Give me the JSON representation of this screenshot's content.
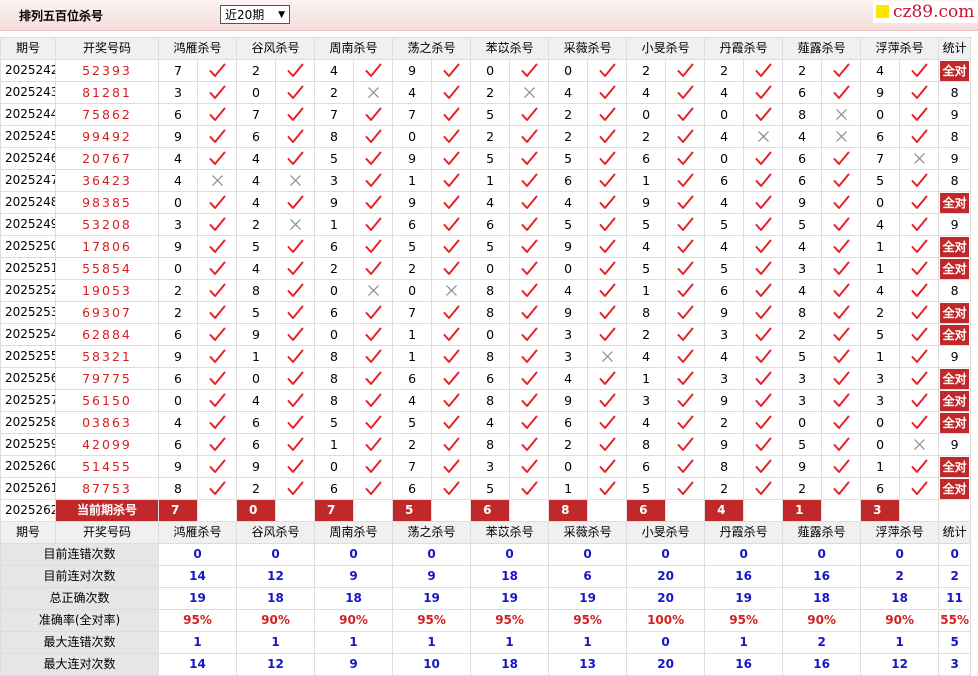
{
  "header": {
    "title": "排列五百位杀号",
    "select_value": "近20期",
    "logo_text": "cz89.com"
  },
  "columns": {
    "issue": "期号",
    "code": "开奖号码",
    "stat": "统计"
  },
  "experts": [
    "鸿雁杀号",
    "谷风杀号",
    "周南杀号",
    "荡之杀号",
    "苯苡杀号",
    "采薇杀号",
    "小旻杀号",
    "丹霞杀号",
    "薤露杀号",
    "浮萍杀号"
  ],
  "rows": [
    {
      "issue": "2025242",
      "code": "52393",
      "picks": [
        7,
        2,
        4,
        9,
        0,
        0,
        2,
        2,
        2,
        4
      ],
      "hits": [
        1,
        1,
        1,
        1,
        1,
        1,
        1,
        1,
        1,
        1
      ],
      "stat": "全对"
    },
    {
      "issue": "2025243",
      "code": "81281",
      "picks": [
        3,
        0,
        2,
        4,
        2,
        4,
        4,
        4,
        6,
        9
      ],
      "hits": [
        1,
        1,
        0,
        1,
        0,
        1,
        1,
        1,
        1,
        1
      ],
      "stat": "8"
    },
    {
      "issue": "2025244",
      "code": "75862",
      "picks": [
        6,
        7,
        7,
        7,
        5,
        2,
        0,
        0,
        8,
        0
      ],
      "hits": [
        1,
        1,
        1,
        1,
        1,
        1,
        1,
        1,
        0,
        1
      ],
      "stat": "9"
    },
    {
      "issue": "2025245",
      "code": "99492",
      "picks": [
        9,
        6,
        8,
        0,
        2,
        2,
        2,
        4,
        4,
        6
      ],
      "hits": [
        1,
        1,
        1,
        1,
        1,
        1,
        1,
        0,
        0,
        1
      ],
      "stat": "8"
    },
    {
      "issue": "2025246",
      "code": "20767",
      "picks": [
        4,
        4,
        5,
        9,
        5,
        5,
        6,
        0,
        6,
        7
      ],
      "hits": [
        1,
        1,
        1,
        1,
        1,
        1,
        1,
        1,
        1,
        0
      ],
      "stat": "9"
    },
    {
      "issue": "2025247",
      "code": "36423",
      "picks": [
        4,
        4,
        3,
        1,
        1,
        6,
        1,
        6,
        6,
        5
      ],
      "hits": [
        0,
        0,
        1,
        1,
        1,
        1,
        1,
        1,
        1,
        1
      ],
      "stat": "8"
    },
    {
      "issue": "2025248",
      "code": "98385",
      "picks": [
        0,
        4,
        9,
        9,
        4,
        4,
        9,
        4,
        9,
        0
      ],
      "hits": [
        1,
        1,
        1,
        1,
        1,
        1,
        1,
        1,
        1,
        1
      ],
      "stat": "全对"
    },
    {
      "issue": "2025249",
      "code": "53208",
      "picks": [
        3,
        2,
        1,
        6,
        6,
        5,
        5,
        5,
        5,
        4
      ],
      "hits": [
        1,
        0,
        1,
        1,
        1,
        1,
        1,
        1,
        1,
        1
      ],
      "stat": "9"
    },
    {
      "issue": "2025250",
      "code": "17806",
      "picks": [
        9,
        5,
        6,
        5,
        5,
        9,
        4,
        4,
        4,
        1
      ],
      "hits": [
        1,
        1,
        1,
        1,
        1,
        1,
        1,
        1,
        1,
        1
      ],
      "stat": "全对"
    },
    {
      "issue": "2025251",
      "code": "55854",
      "picks": [
        0,
        4,
        2,
        2,
        0,
        0,
        5,
        5,
        3,
        1
      ],
      "hits": [
        1,
        1,
        1,
        1,
        1,
        1,
        1,
        1,
        1,
        1
      ],
      "stat": "全对"
    },
    {
      "issue": "2025252",
      "code": "19053",
      "picks": [
        2,
        8,
        0,
        0,
        8,
        4,
        1,
        6,
        4,
        4
      ],
      "hits": [
        1,
        1,
        0,
        0,
        1,
        1,
        1,
        1,
        1,
        1
      ],
      "stat": "8"
    },
    {
      "issue": "2025253",
      "code": "69307",
      "picks": [
        2,
        5,
        6,
        7,
        8,
        9,
        8,
        9,
        8,
        2
      ],
      "hits": [
        1,
        1,
        1,
        1,
        1,
        1,
        1,
        1,
        1,
        1
      ],
      "stat": "全对"
    },
    {
      "issue": "2025254",
      "code": "62884",
      "picks": [
        6,
        9,
        0,
        1,
        0,
        3,
        2,
        3,
        2,
        5
      ],
      "hits": [
        1,
        1,
        1,
        1,
        1,
        1,
        1,
        1,
        1,
        1
      ],
      "stat": "全对"
    },
    {
      "issue": "2025255",
      "code": "58321",
      "picks": [
        9,
        1,
        8,
        1,
        8,
        3,
        4,
        4,
        5,
        1
      ],
      "hits": [
        1,
        1,
        1,
        1,
        1,
        0,
        1,
        1,
        1,
        1
      ],
      "stat": "9"
    },
    {
      "issue": "2025256",
      "code": "79775",
      "picks": [
        6,
        0,
        8,
        6,
        6,
        4,
        1,
        3,
        3,
        3
      ],
      "hits": [
        1,
        1,
        1,
        1,
        1,
        1,
        1,
        1,
        1,
        1
      ],
      "stat": "全对"
    },
    {
      "issue": "2025257",
      "code": "56150",
      "picks": [
        0,
        4,
        8,
        4,
        8,
        9,
        3,
        9,
        3,
        3
      ],
      "hits": [
        1,
        1,
        1,
        1,
        1,
        1,
        1,
        1,
        1,
        1
      ],
      "stat": "全对"
    },
    {
      "issue": "2025258",
      "code": "03863",
      "picks": [
        4,
        6,
        5,
        5,
        4,
        6,
        4,
        2,
        0,
        0
      ],
      "hits": [
        1,
        1,
        1,
        1,
        1,
        1,
        1,
        1,
        1,
        1
      ],
      "stat": "全对"
    },
    {
      "issue": "2025259",
      "code": "42099",
      "picks": [
        6,
        6,
        1,
        2,
        8,
        2,
        8,
        9,
        5,
        0
      ],
      "hits": [
        1,
        1,
        1,
        1,
        1,
        1,
        1,
        1,
        1,
        0
      ],
      "stat": "9"
    },
    {
      "issue": "2025260",
      "code": "51455",
      "picks": [
        9,
        9,
        0,
        7,
        3,
        0,
        6,
        8,
        9,
        1
      ],
      "hits": [
        1,
        1,
        1,
        1,
        1,
        1,
        1,
        1,
        1,
        1
      ],
      "stat": "全对"
    },
    {
      "issue": "2025261",
      "code": "87753",
      "picks": [
        8,
        2,
        6,
        6,
        5,
        1,
        5,
        2,
        2,
        6
      ],
      "hits": [
        1,
        1,
        1,
        1,
        1,
        1,
        1,
        1,
        1,
        1
      ],
      "stat": "全对"
    }
  ],
  "current": {
    "issue": "2025262",
    "label": "当前期杀号",
    "picks": [
      7,
      0,
      7,
      5,
      6,
      8,
      6,
      4,
      1,
      3
    ]
  },
  "summary": [
    {
      "label": "目前连错次数",
      "values": [
        "0",
        "0",
        "0",
        "0",
        "0",
        "0",
        "0",
        "0",
        "0",
        "0"
      ],
      "stat": "0"
    },
    {
      "label": "目前连对次数",
      "values": [
        "14",
        "12",
        "9",
        "9",
        "18",
        "6",
        "20",
        "16",
        "16",
        "2"
      ],
      "stat": "2"
    },
    {
      "label": "总正确次数",
      "values": [
        "19",
        "18",
        "18",
        "19",
        "19",
        "19",
        "20",
        "19",
        "18",
        "18"
      ],
      "stat": "11"
    },
    {
      "label": "准确率(全对率)",
      "values": [
        "95%",
        "90%",
        "90%",
        "95%",
        "95%",
        "95%",
        "100%",
        "95%",
        "90%",
        "90%"
      ],
      "stat": "55%",
      "is_rate": true
    },
    {
      "label": "最大连错次数",
      "values": [
        "1",
        "1",
        "1",
        "1",
        "1",
        "1",
        "0",
        "1",
        "2",
        "1"
      ],
      "stat": "5"
    },
    {
      "label": "最大连对次数",
      "values": [
        "14",
        "12",
        "9",
        "10",
        "18",
        "13",
        "20",
        "16",
        "16",
        "12"
      ],
      "stat": "3"
    }
  ],
  "colors": {
    "accent_red": "#c0282a",
    "check_red": "#e0242a",
    "cross_gray": "#888888",
    "stat_blue": "#1616c8"
  }
}
